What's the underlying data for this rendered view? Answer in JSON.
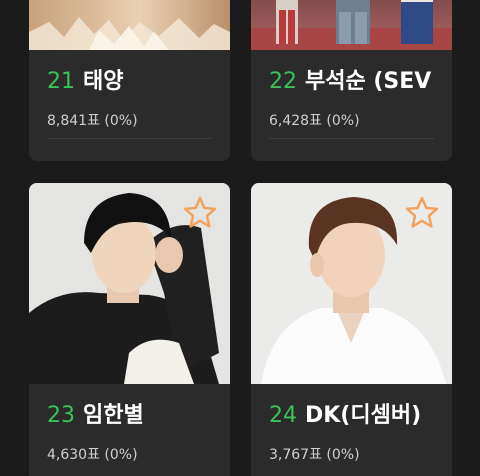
{
  "colors": {
    "background": "#1b1b1b",
    "card": "#2b2b2b",
    "rank_green": "#3ac25b",
    "star_orange": "#f3a15a"
  },
  "cards": [
    {
      "rank": "21",
      "name": "태양",
      "votes": "8,841표 (0%)",
      "icon": "star-outline-icon"
    },
    {
      "rank": "22",
      "name": "부석순 (SEV",
      "votes": "6,428표 (0%)",
      "icon": "star-outline-icon"
    },
    {
      "rank": "23",
      "name": "임한별",
      "votes": "4,630표 (0%)",
      "icon": "star-outline-icon"
    },
    {
      "rank": "24",
      "name": "DK(디셈버)",
      "votes": "3,767표 (0%)",
      "icon": "star-outline-icon"
    }
  ]
}
